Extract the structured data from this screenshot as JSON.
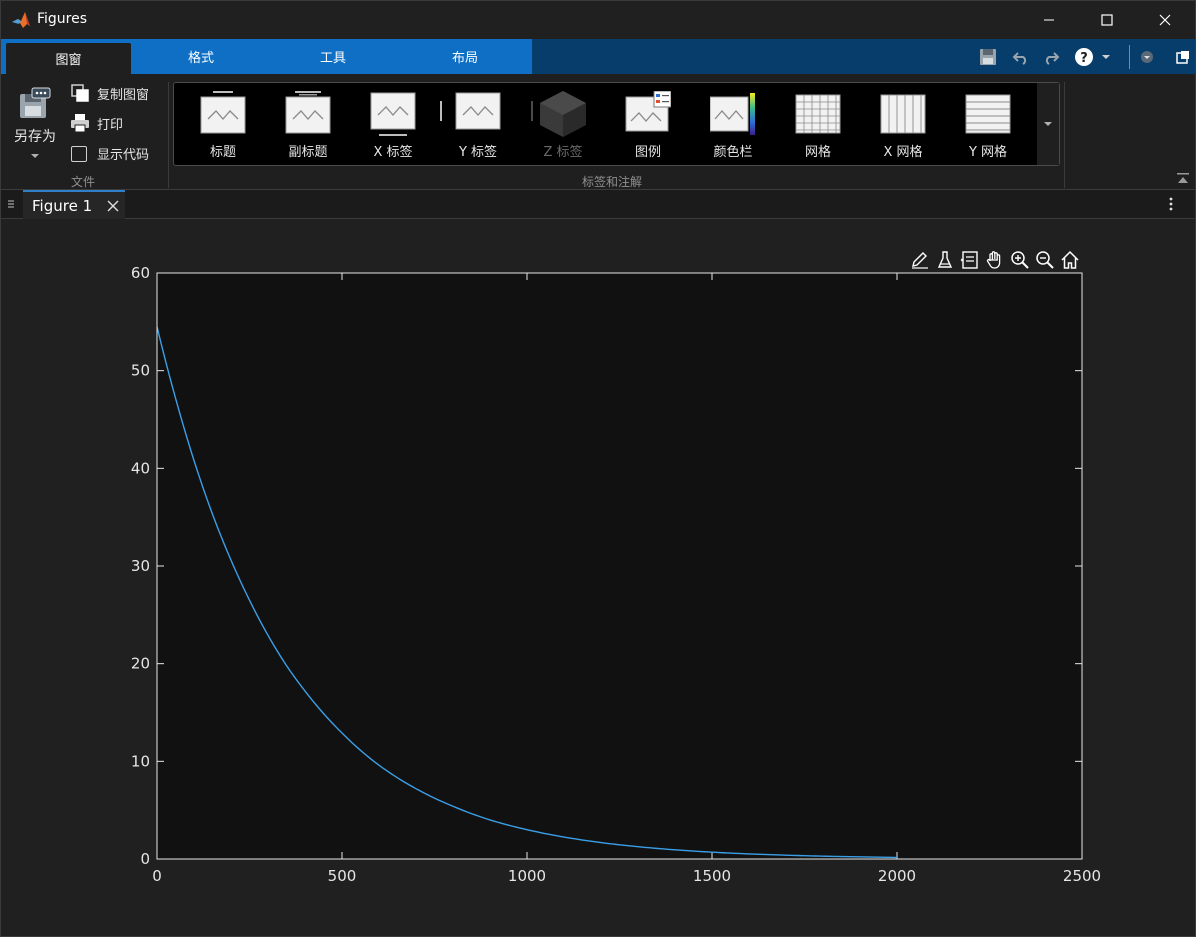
{
  "window": {
    "title": "Figures",
    "controls": {
      "minimize": "minimize",
      "maximize": "maximize",
      "close": "close"
    }
  },
  "tabs": [
    {
      "label": "图窗",
      "active": true
    },
    {
      "label": "格式",
      "active": false
    },
    {
      "label": "工具",
      "active": false
    },
    {
      "label": "布局",
      "active": false
    }
  ],
  "file_section": {
    "save_as_label": "另存为",
    "copy_figure_label": "复制图窗",
    "print_label": "打印",
    "show_code_label": "显示代码",
    "show_code_checked": false,
    "section_label": "文件"
  },
  "labels_section": {
    "section_label": "标签和注解",
    "items": [
      {
        "label": "标题",
        "icon": "title-icon",
        "enabled": true
      },
      {
        "label": "副标题",
        "icon": "subtitle-icon",
        "enabled": true
      },
      {
        "label": "X 标签",
        "icon": "xlabel-icon",
        "enabled": true
      },
      {
        "label": "Y 标签",
        "icon": "ylabel-icon",
        "enabled": true
      },
      {
        "label": "Z 标签",
        "icon": "zlabel-icon",
        "enabled": false
      },
      {
        "label": "图例",
        "icon": "legend-icon",
        "enabled": true
      },
      {
        "label": "颜色栏",
        "icon": "colorbar-icon",
        "enabled": true
      },
      {
        "label": "网格",
        "icon": "grid-icon",
        "enabled": true
      },
      {
        "label": "X 网格",
        "icon": "xgrid-icon",
        "enabled": true
      },
      {
        "label": "Y 网格",
        "icon": "ygrid-icon",
        "enabled": true
      }
    ]
  },
  "document": {
    "tab_label": "Figure 1"
  },
  "colors": {
    "accent": "#0e6fc4",
    "tab_dark": "#063d6b",
    "line": "#3b9fe8",
    "axes_bg": "#111111",
    "figure_bg": "#202020"
  },
  "chart_data": {
    "type": "line",
    "title": "",
    "xlabel": "",
    "ylabel": "",
    "xlim": [
      0,
      2500
    ],
    "ylim": [
      0,
      60
    ],
    "xticks": [
      0,
      500,
      1000,
      1500,
      2000,
      2500
    ],
    "yticks": [
      0,
      10,
      20,
      30,
      40,
      50,
      60
    ],
    "grid": false,
    "series": [
      {
        "x": [
          0,
          50,
          100,
          150,
          200,
          250,
          300,
          350,
          400,
          450,
          500,
          600,
          700,
          800,
          900,
          1000,
          1100,
          1200,
          1300,
          1400,
          1500,
          1600,
          1700,
          1800,
          1900,
          2000
        ],
        "y": [
          54.5,
          47.2,
          40.8,
          35.3,
          30.6,
          26.5,
          22.9,
          19.8,
          17.2,
          14.9,
          12.9,
          9.6,
          7.2,
          5.4,
          4.0,
          3.0,
          2.25,
          1.68,
          1.26,
          0.94,
          0.7,
          0.52,
          0.39,
          0.29,
          0.22,
          0.16
        ]
      }
    ]
  }
}
